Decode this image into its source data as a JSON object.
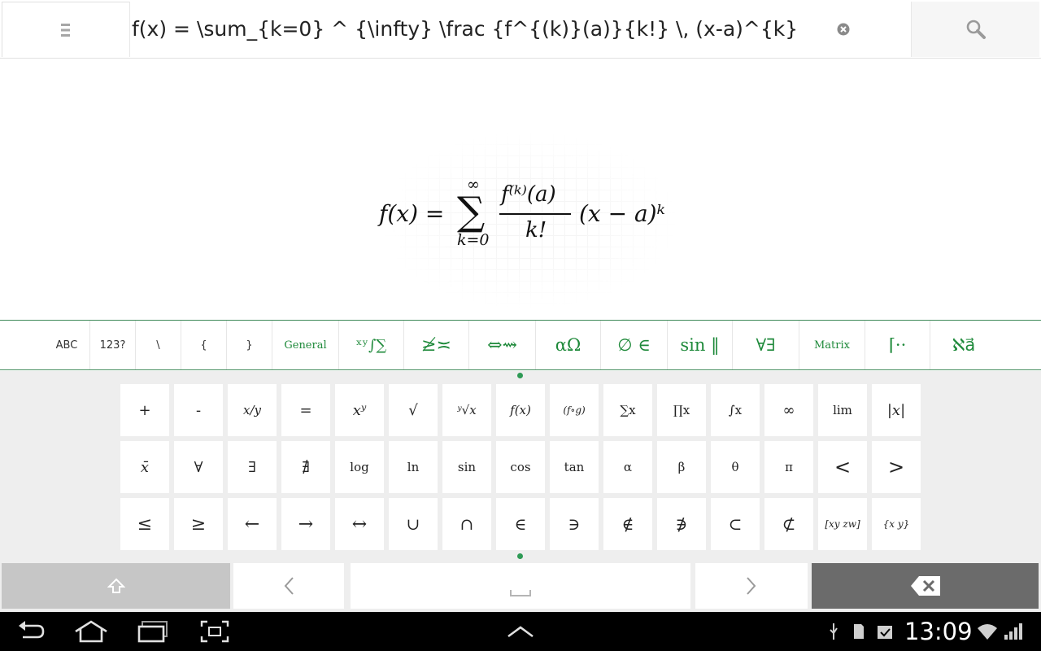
{
  "search": {
    "query": "f(x) = \\sum_{k=0} ^ {\\infty} \\frac {f^{(k)}(a)}{k!} \\, (x-a)^{k}"
  },
  "help": {
    "label": "?"
  },
  "formula": {
    "lhs": "f(x) =",
    "sum_symbol": "∑",
    "sum_upper": "∞",
    "sum_lower": "k=0",
    "numerator": "f⁽ᵏ⁾(a)",
    "denominator": "k!",
    "rhs": "(x − a)ᵏ"
  },
  "categories": [
    {
      "label": "ABC",
      "style": "plain"
    },
    {
      "label": "123?",
      "style": "plain"
    },
    {
      "label": "\\",
      "style": "plain"
    },
    {
      "label": "{",
      "style": "plain"
    },
    {
      "label": "}",
      "style": "plain"
    },
    {
      "label": "General",
      "style": "green"
    },
    {
      "label": "ˣʸ∫∑",
      "style": "green"
    },
    {
      "label": "≱≍",
      "style": "green"
    },
    {
      "label": "⇔⇝",
      "style": "green"
    },
    {
      "label": "αΩ",
      "style": "green"
    },
    {
      "label": "∅ ∈",
      "style": "green"
    },
    {
      "label": "sin ‖",
      "style": "green"
    },
    {
      "label": "∀∃",
      "style": "green"
    },
    {
      "label": "Matrix",
      "style": "green"
    },
    {
      "label": "⌈··",
      "style": "green"
    },
    {
      "label": "ℵa⃗",
      "style": "green"
    }
  ],
  "keyboard": {
    "rows": [
      [
        "+",
        "-",
        "x/y",
        "=",
        "xʸ",
        "√",
        "ʸ√x",
        "f(x)",
        "(f∘g)",
        "∑x",
        "∏x",
        "∫x",
        "∞",
        "lim",
        "|x|"
      ],
      [
        "x̄",
        "∀",
        "∃",
        "∄",
        "log",
        "ln",
        "sin",
        "cos",
        "tan",
        "α",
        "β",
        "θ",
        "π",
        "<",
        ">"
      ],
      [
        "≤",
        "≥",
        "←",
        "→",
        "↔",
        "∪",
        "∩",
        "∈",
        "∋",
        "∉",
        "∌",
        "⊂",
        "⊄",
        "[xy zw]",
        "{x y}"
      ]
    ],
    "shift_icon": "⇧",
    "left_icon": "‹",
    "space_icon": "⎵",
    "right_icon": "›",
    "delete_icon": "⌫"
  },
  "status": {
    "time": "13:09"
  }
}
